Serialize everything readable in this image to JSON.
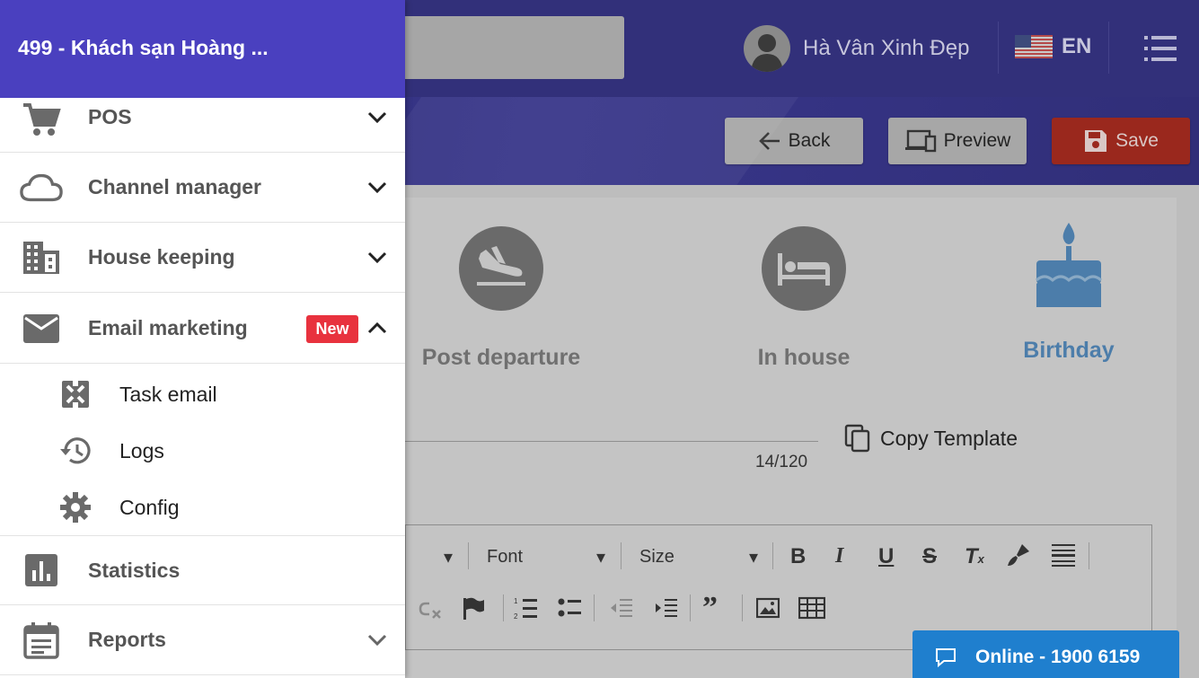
{
  "header": {
    "user_name": "Hà Vân Xinh Đẹp",
    "language": "EN",
    "icons": [
      "avatar-icon",
      "us-flag-icon",
      "menu-list-icon"
    ]
  },
  "actions": {
    "back_label": "Back",
    "preview_label": "Preview",
    "save_label": "Save"
  },
  "templates": {
    "tiles": [
      {
        "label": "Post departure",
        "icon": "plane-landing-icon"
      },
      {
        "label": "In house",
        "icon": "bed-icon"
      },
      {
        "label": "Birthday",
        "icon": "cake-icon",
        "active": true
      }
    ],
    "counter": "14/120",
    "copy_label": "Copy Template"
  },
  "editor": {
    "font_label": "Font",
    "size_label": "Size"
  },
  "support": {
    "online_label": "Online - 1900 6159"
  },
  "sidebar": {
    "title": "499 - Khách sạn Hoàng ...",
    "items": [
      {
        "label": "POS",
        "icon": "cart-icon",
        "expanded": false
      },
      {
        "label": "Channel manager",
        "icon": "cloud-icon",
        "expanded": false
      },
      {
        "label": "House keeping",
        "icon": "building-icon",
        "expanded": false
      },
      {
        "label": "Email marketing",
        "icon": "mail-icon",
        "expanded": true,
        "badge": "New"
      },
      {
        "label": "Statistics",
        "icon": "bar-chart-icon"
      },
      {
        "label": "Reports",
        "icon": "calendar-list-icon",
        "expanded": false
      }
    ],
    "email_subitems": [
      {
        "label": "Task email",
        "icon": "task-icon"
      },
      {
        "label": "Logs",
        "icon": "history-icon"
      },
      {
        "label": "Config",
        "icon": "gear-icon"
      }
    ]
  },
  "colors": {
    "sidebar_header": "#4a40bf",
    "topbar": "#32307a",
    "badge": "#e8323e",
    "online_button": "#1f7fce",
    "birthday_accent": "#4c7daa"
  }
}
